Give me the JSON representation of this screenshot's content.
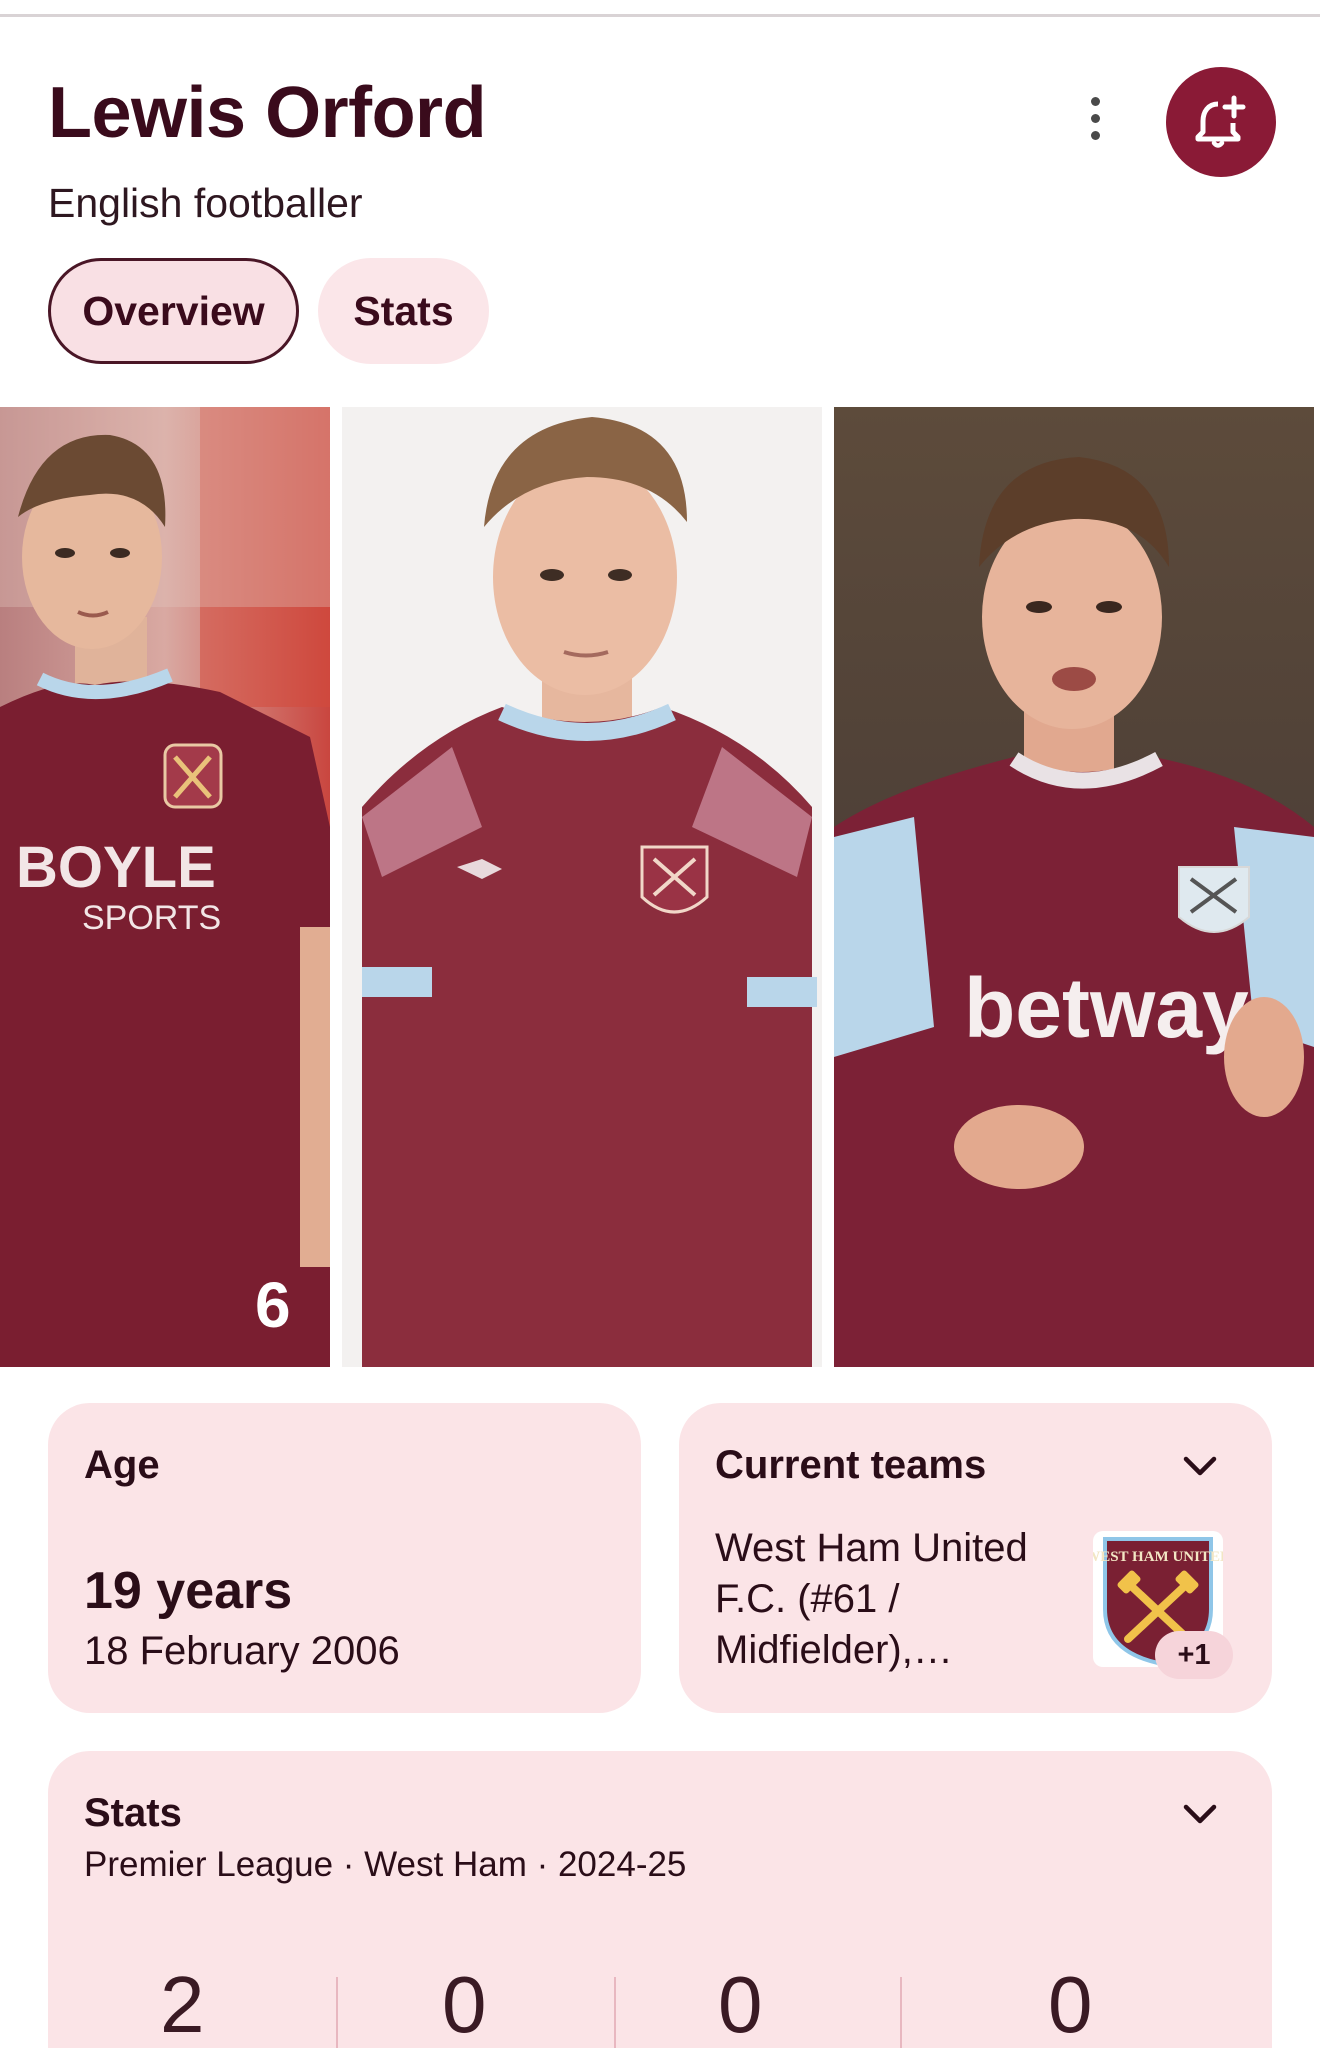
{
  "header": {
    "name": "Lewis Orford",
    "description": "English footballer"
  },
  "actions": {
    "more_icon": "more-vertical-icon",
    "follow_icon": "bell-plus-icon"
  },
  "tabs": [
    {
      "label": "Overview",
      "selected": true
    },
    {
      "label": "Stats",
      "selected": false
    }
  ],
  "images": [
    {
      "kit_sponsor": "BOYLE",
      "kit_sponsor_line2": "SPORTS",
      "shirt_number": "6"
    },
    {
      "kit_sponsor": ""
    },
    {
      "kit_sponsor": "betway"
    }
  ],
  "age_card": {
    "label": "Age",
    "value": "19 years",
    "birth_date": "18 February 2006"
  },
  "teams_card": {
    "label": "Current teams",
    "text": "West Ham United F.C. (#61 / Midfielder),…",
    "more_count": "+1",
    "crest_text": "WEST HAM UNITED"
  },
  "stats_card": {
    "label": "Stats",
    "subtitle": "Premier League · West Ham · 2024-25",
    "values": [
      "2",
      "0",
      "0",
      "0"
    ]
  },
  "colors": {
    "accent": "#8a1a36",
    "card_bg": "#fbe4e7",
    "chip_bg": "#f9e0e4",
    "title_text": "#3a0b1c"
  }
}
